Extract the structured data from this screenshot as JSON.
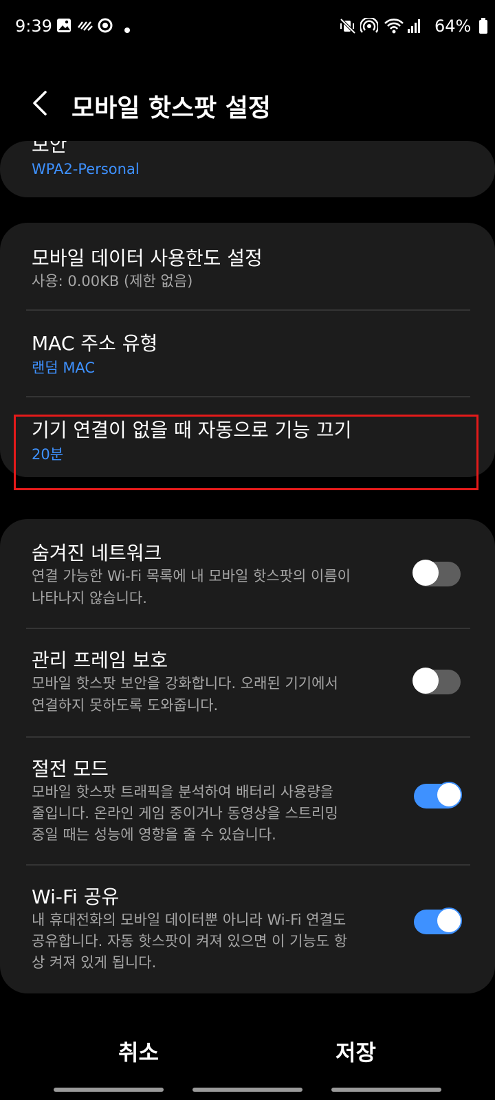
{
  "status_bar": {
    "time": "9:39",
    "battery": "64%",
    "left_icons": [
      "gallery-icon",
      "signal-wave-icon",
      "circle-app-icon",
      "dot-icon"
    ],
    "right_icons": [
      "vibrate-mute-icon",
      "hotspot-icon",
      "wifi-icon",
      "cell-signal-icon",
      "battery-icon"
    ]
  },
  "header": {
    "title": "모바일 핫스팟 설정"
  },
  "security": {
    "title": "보안",
    "value": "WPA2-Personal"
  },
  "card2": {
    "data_limit": {
      "title": "모바일 데이터 사용한도 설정",
      "sub": "사용: 0.00KB (제한 없음)"
    },
    "mac": {
      "title": "MAC 주소 유형",
      "sub": "랜덤 MAC"
    },
    "auto_off": {
      "title": "기기 연결이 없을 때 자동으로 기능 끄기",
      "sub": "20분"
    }
  },
  "card3": {
    "hidden_network": {
      "title": "숨겨진 네트워크",
      "sub1": "연결 가능한 Wi-Fi 목록에 내 모바일 핫스팟의 이름이",
      "sub2": "나타나지 않습니다.",
      "on": false
    },
    "pmf": {
      "title": "관리 프레임 보호",
      "sub1": "모바일 핫스팟 보안을 강화합니다. 오래된 기기에서",
      "sub2": "연결하지 못하도록 도와줍니다.",
      "on": false
    },
    "power_saving": {
      "title": "절전 모드",
      "sub1": "모바일 핫스팟 트래픽을 분석하여 배터리 사용량을",
      "sub2": "줄입니다. 온라인 게임 중이거나 동영상을 스트리밍",
      "sub3": "중일 때는 성능에 영향을 줄 수 있습니다.",
      "on": true
    },
    "wifi_sharing": {
      "title": "Wi-Fi 공유",
      "sub1": "내 휴대전화의 모바일 데이터뿐 아니라 Wi-Fi 연결도",
      "sub2": "공유합니다. 자동 핫스팟이 켜져 있으면 이 기능도 항",
      "sub3": "상 켜져 있게 됩니다.",
      "on": true
    }
  },
  "buttons": {
    "cancel": "취소",
    "save": "저장"
  },
  "colors": {
    "accent": "#3e91ff",
    "highlight_box": "#e41a1a",
    "card": "#1c1c1c"
  }
}
